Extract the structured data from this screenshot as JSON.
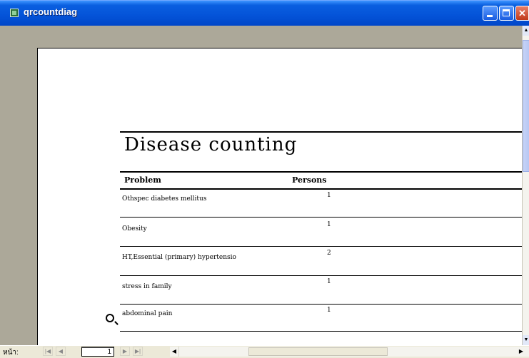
{
  "window": {
    "title": "qrcountdiag",
    "minimize_icon": "minimize-icon",
    "maximize_icon": "maximize-icon",
    "close_icon": "close-icon"
  },
  "report": {
    "title": "Disease counting",
    "columns": {
      "problem": "Problem",
      "persons": "Persons"
    },
    "rows": [
      {
        "problem": "Othspec diabetes mellitus",
        "persons": "1"
      },
      {
        "problem": "Obesity",
        "persons": "1"
      },
      {
        "problem": "HT,Essential (primary) hypertensio",
        "persons": "2"
      },
      {
        "problem": "stress in family",
        "persons": "1"
      },
      {
        "problem": "abdominal pain",
        "persons": "1"
      }
    ]
  },
  "navigation": {
    "page_label": "หน้า:",
    "current_page": "1",
    "first_icon": "first-page-icon",
    "prev_icon": "previous-page-icon",
    "next_icon": "next-page-icon",
    "last_icon": "last-page-icon"
  }
}
